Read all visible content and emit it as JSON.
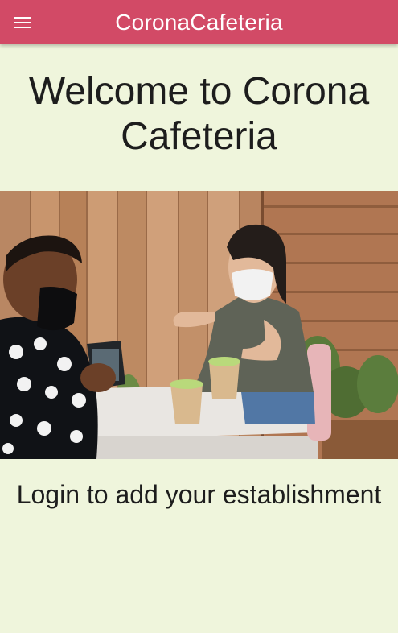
{
  "app_bar": {
    "title": "CoronaCafeteria",
    "menu_icon": "hamburger-menu-icon",
    "background_color": "#d24a66",
    "title_color": "#ffffff"
  },
  "main": {
    "background_color": "#eff5dc",
    "welcome_heading": "Welcome to Corona Cafeteria",
    "hero_image": {
      "subject": "two people wearing face masks talking at an outdoor cafe table"
    },
    "login_message": "Login to add your establishment"
  }
}
